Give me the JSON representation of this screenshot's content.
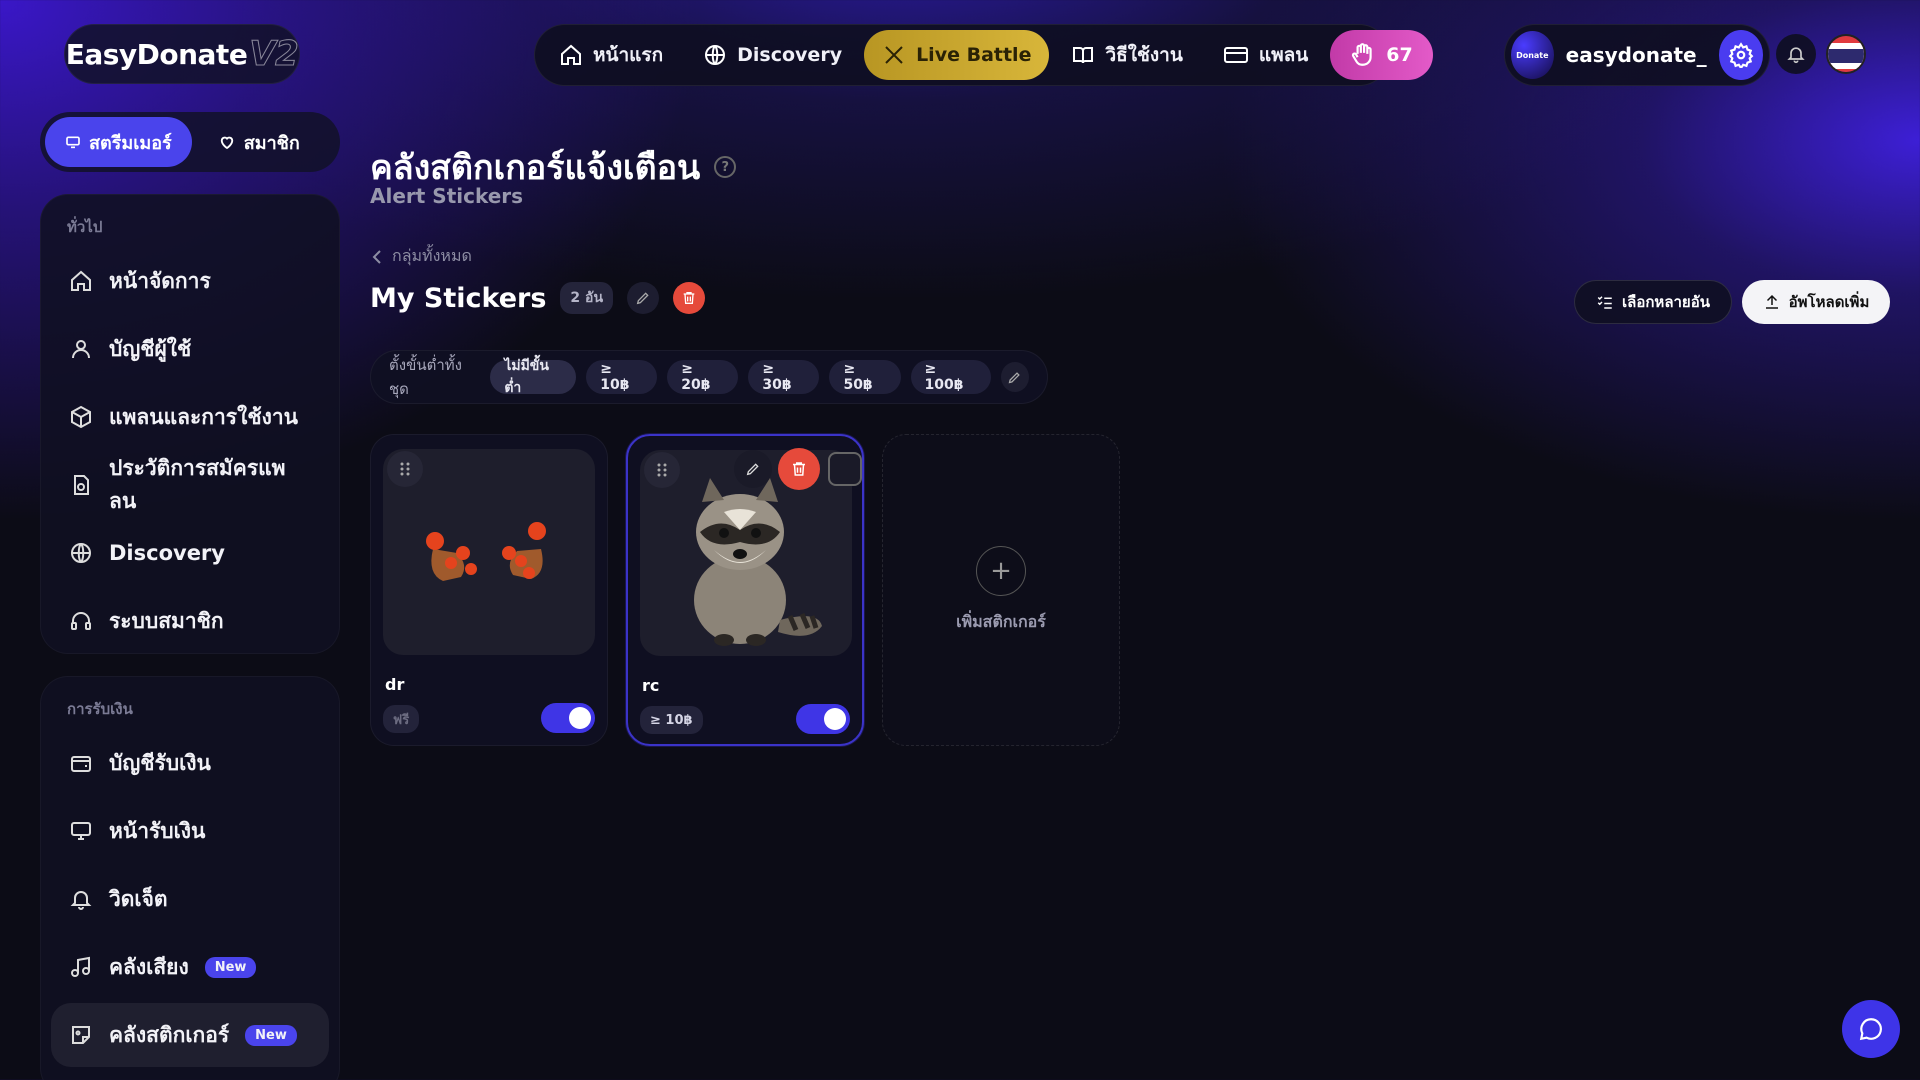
{
  "app": {
    "logo_text": "EasyDonate",
    "logo_version": "V2"
  },
  "topnav": {
    "home": "หน้าแรก",
    "discovery": "Discovery",
    "live_battle": "Live Battle",
    "howto": "วิธีใช้งาน",
    "plan": "แพลน",
    "hand_count": "67"
  },
  "user": {
    "avatar_text": "Donate",
    "username": "easydonate_"
  },
  "roles": {
    "streamer": "สตรีมเมอร์",
    "member": "สมาชิก"
  },
  "sidebar": {
    "general_head": "ทั่วไป",
    "general": [
      {
        "label": "หน้าจัดการ"
      },
      {
        "label": "บัญชีผู้ใช้"
      },
      {
        "label": "แพลนและการใช้งาน"
      },
      {
        "label": "ประวัติการสมัครแพลน"
      },
      {
        "label": "Discovery"
      },
      {
        "label": "ระบบสมาชิก"
      }
    ],
    "payment_head": "การรับเงิน",
    "payment": [
      {
        "label": "บัญชีรับเงิน"
      },
      {
        "label": "หน้ารับเงิน"
      },
      {
        "label": "วิดเจ็ต"
      },
      {
        "label": "คลังเสียง",
        "badge": "New"
      },
      {
        "label": "คลังสติกเกอร์",
        "badge": "New"
      }
    ]
  },
  "page": {
    "title": "คลังสติกเกอร์แจ้งเตือน",
    "help": "?",
    "subtitle": "Alert Stickers",
    "back": "กลุ่มทั้งหมด",
    "group_title": "My Stickers",
    "group_count": "2 อัน",
    "select_multi": "เลือกหลายอัน",
    "upload_more": "อัพโหลดเพิ่ม"
  },
  "filter": {
    "label": "ตั้งขั้นต่ำทั้งชุด",
    "chips": [
      "ไม่มีขั้นต่ำ",
      "≥ 10฿",
      "≥ 20฿",
      "≥ 30฿",
      "≥ 50฿",
      "≥ 100฿"
    ]
  },
  "stickers": [
    {
      "name": "dr",
      "price": "ฟรี",
      "enabled": true
    },
    {
      "name": "rc",
      "price": "≥ 10฿",
      "enabled": true
    }
  ],
  "add_sticker": {
    "plus": "+",
    "label": "เพิ่มสติกเกอร์"
  },
  "colors": {
    "accent": "#4a44ec",
    "live": "#d0ad32",
    "hand": "#d94ac0",
    "danger": "#e64a3b"
  }
}
